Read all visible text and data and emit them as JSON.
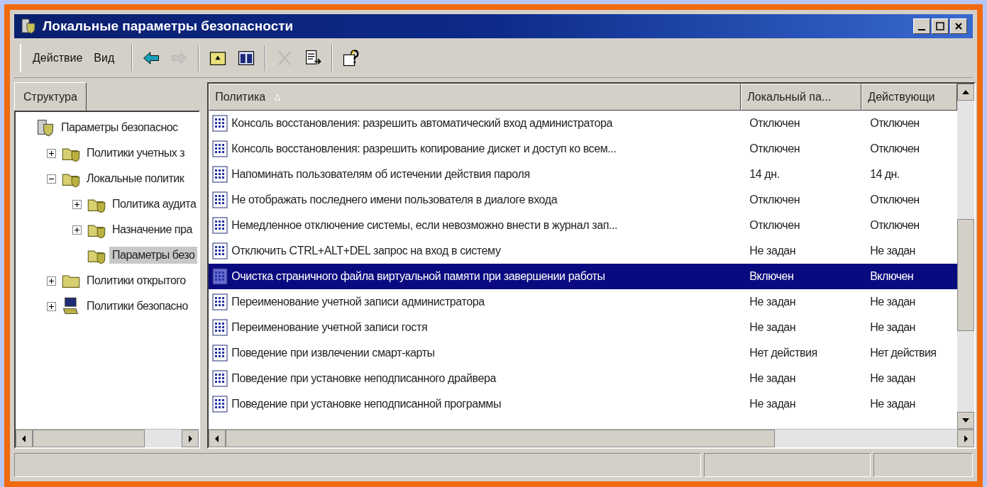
{
  "window": {
    "title": "Локальные параметры безопасности"
  },
  "menu": [
    {
      "label": "Действие"
    },
    {
      "label": "Вид"
    }
  ],
  "toolbar": [
    {
      "kind": "back",
      "disabled": false
    },
    {
      "kind": "forward",
      "disabled": true
    },
    {
      "kind": "up",
      "disabled": false
    },
    {
      "kind": "tree",
      "disabled": false
    },
    {
      "kind": "delete",
      "disabled": true
    },
    {
      "kind": "export",
      "disabled": false
    },
    {
      "kind": "help",
      "disabled": false
    }
  ],
  "tree_tab": {
    "label": "Структура"
  },
  "tree": [
    {
      "label": "Параметры безопаснос",
      "kind": "root",
      "selected": false,
      "children": [
        {
          "label": "Политики учетных з",
          "kind": "folder",
          "expanded": false,
          "selected": false
        },
        {
          "label": "Локальные политик",
          "kind": "folder",
          "expanded": true,
          "selected": false,
          "children": [
            {
              "label": "Политика аудита",
              "kind": "folder",
              "expanded": false,
              "selected": false
            },
            {
              "label": "Назначение пра",
              "kind": "folder",
              "expanded": false,
              "selected": false
            },
            {
              "label": "Параметры безо",
              "kind": "folder",
              "selected": true
            }
          ]
        },
        {
          "label": "Политики открытого",
          "kind": "plainfolder",
          "expanded": false,
          "selected": false
        },
        {
          "label": "Политики безопасно",
          "kind": "computer",
          "expanded": false,
          "selected": false
        }
      ]
    }
  ],
  "table": {
    "columns": [
      "Политика",
      "Локальный па...",
      "Действующи"
    ],
    "rows": [
      {
        "policy": "Консоль восстановления: разрешить автоматический вход администратора",
        "local": "Отключен",
        "effective": "Отключен",
        "selected": false
      },
      {
        "policy": "Консоль восстановления: разрешить копирование дискет и доступ ко всем...",
        "local": "Отключен",
        "effective": "Отключен",
        "selected": false
      },
      {
        "policy": "Напоминать пользователям об истечении действия пароля",
        "local": "14 дн.",
        "effective": "14 дн.",
        "selected": false
      },
      {
        "policy": "Не отображать последнего имени пользователя в диалоге входа",
        "local": "Отключен",
        "effective": "Отключен",
        "selected": false
      },
      {
        "policy": "Немедленное отключение системы, если невозможно внести в журнал зап...",
        "local": "Отключен",
        "effective": "Отключен",
        "selected": false
      },
      {
        "policy": "Отключить CTRL+ALT+DEL запрос на вход в систему",
        "local": "Не задан",
        "effective": "Не задан",
        "selected": false
      },
      {
        "policy": "Очистка страничного файла виртуальной памяти при завершении работы",
        "local": "Включен",
        "effective": "Включен",
        "selected": true
      },
      {
        "policy": "Переименование учетной записи администратора",
        "local": "Не задан",
        "effective": "Не задан",
        "selected": false
      },
      {
        "policy": "Переименование учетной записи гостя",
        "local": "Не задан",
        "effective": "Не задан",
        "selected": false
      },
      {
        "policy": "Поведение при извлечении смарт-карты",
        "local": "Нет действия",
        "effective": "Нет действия",
        "selected": false
      },
      {
        "policy": "Поведение при установке неподписанного драйвера",
        "local": "Не задан",
        "effective": "Не задан",
        "selected": false
      },
      {
        "policy": "Поведение при установке неподписанной программы",
        "local": "Не задан",
        "effective": "Не задан",
        "selected": false
      }
    ]
  }
}
